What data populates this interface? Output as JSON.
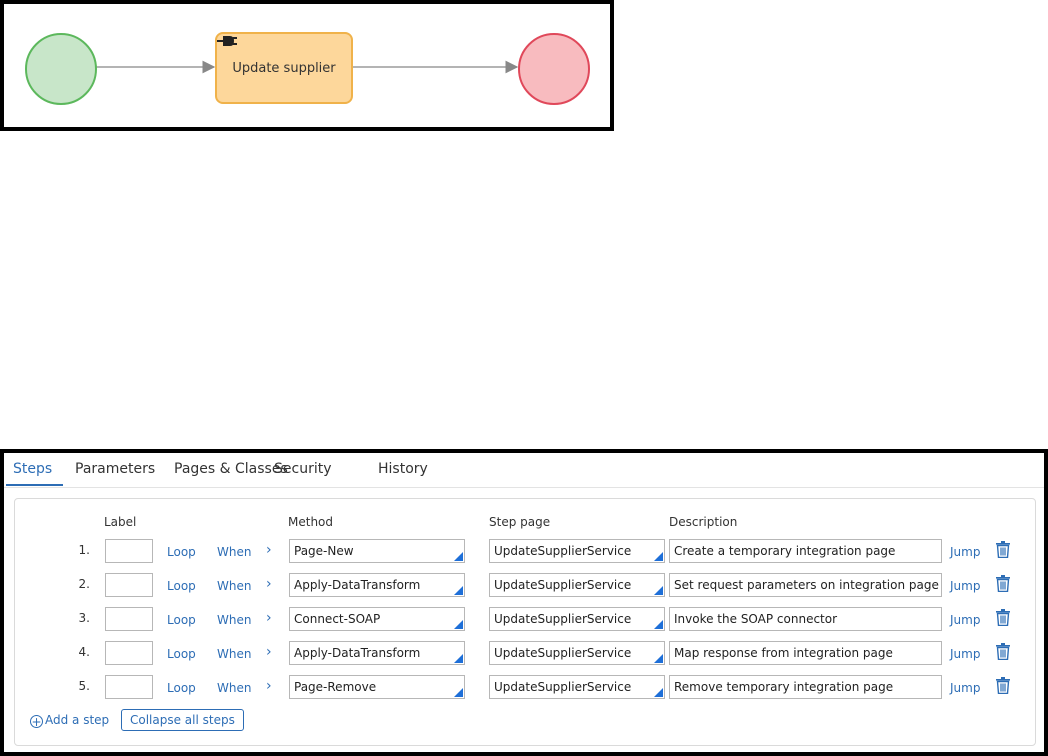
{
  "diagram": {
    "task_label": "Update supplier",
    "colors": {
      "start_fill": "#c8e6c9",
      "start_border": "#5cb85c",
      "task_fill": "#fdd79b",
      "task_border": "#f0b24a",
      "end_fill": "#f8bbbf",
      "end_border": "#e0485a",
      "connector": "#888888"
    },
    "task_icon": "plug-icon"
  },
  "tabs": [
    {
      "label": "Steps",
      "active": true
    },
    {
      "label": "Parameters",
      "active": false
    },
    {
      "label": "Pages & Classes",
      "active": false
    },
    {
      "label": "Security",
      "active": false
    },
    {
      "label": "History",
      "active": false
    }
  ],
  "columns": {
    "label": "Label",
    "method": "Method",
    "step_page": "Step page",
    "description": "Description"
  },
  "links": {
    "loop": "Loop",
    "when": "When",
    "jump": "Jump"
  },
  "steps": [
    {
      "num": "1.",
      "label": "",
      "method": "Page-New",
      "step_page": "UpdateSupplierService",
      "description": "Create a temporary integration page"
    },
    {
      "num": "2.",
      "label": "",
      "method": "Apply-DataTransform",
      "step_page": "UpdateSupplierService",
      "description": "Set request parameters on integration page"
    },
    {
      "num": "3.",
      "label": "",
      "method": "Connect-SOAP",
      "step_page": "UpdateSupplierService",
      "description": "Invoke the SOAP connector"
    },
    {
      "num": "4.",
      "label": "",
      "method": "Apply-DataTransform",
      "step_page": "UpdateSupplierService",
      "description": "Map response from  integration page"
    },
    {
      "num": "5.",
      "label": "",
      "method": "Page-Remove",
      "step_page": "UpdateSupplierService",
      "description": "Remove temporary integration page"
    }
  ],
  "footer": {
    "add_step": "Add a step",
    "collapse": "Collapse all steps"
  },
  "accent_color": "#2d6db5"
}
